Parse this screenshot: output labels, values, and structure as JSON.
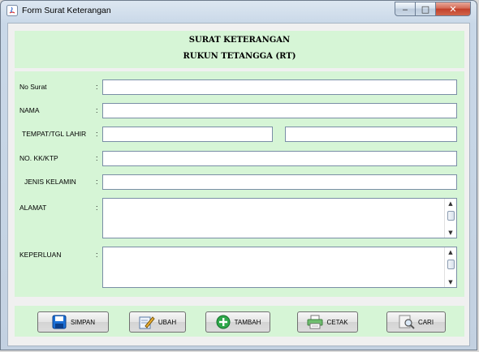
{
  "window": {
    "title": "Form Surat Keterangan",
    "controls": {
      "minimize": "‒",
      "maximize": "□",
      "close": "✕"
    }
  },
  "header": {
    "line1": "SURAT KETERANGAN",
    "line2": "RUKUN TETANGGA (RT)"
  },
  "form": {
    "colon": ":",
    "fields": {
      "no_surat": {
        "label": "No Surat",
        "value": ""
      },
      "nama": {
        "label": "NAMA",
        "value": ""
      },
      "tempat_tgl_lahir": {
        "label": "TEMPAT/TGL LAHIR",
        "tempat": "",
        "tgl": ""
      },
      "no_kk_ktp": {
        "label": "NO. KK/KTP",
        "value": ""
      },
      "jenis_kelamin": {
        "label": "JENIS KELAMIN",
        "value": ""
      },
      "alamat": {
        "label": "ALAMAT",
        "value": ""
      },
      "keperluan": {
        "label": "KEPERLUAN",
        "value": ""
      }
    }
  },
  "buttons": {
    "simpan": {
      "label": "SIMPAN",
      "icon": "save-icon"
    },
    "ubah": {
      "label": "UBAH",
      "icon": "edit-icon"
    },
    "tambah": {
      "label": "TAMBAH",
      "icon": "add-icon"
    },
    "cetak": {
      "label": "CETAK",
      "icon": "printer-icon"
    },
    "cari": {
      "label": "CARI",
      "icon": "search-icon"
    }
  },
  "colors": {
    "panel_bg": "#d6f5d6",
    "client_bg": "#f0f0f0",
    "close_button": "#c2402a"
  }
}
